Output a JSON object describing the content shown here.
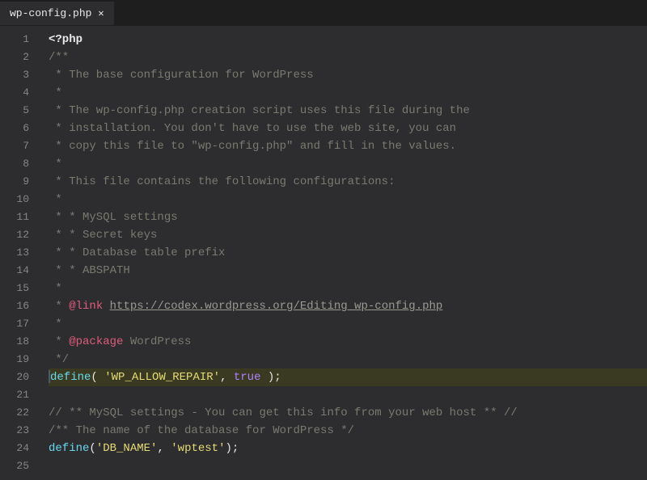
{
  "tab": {
    "filename": "wp-config.php",
    "close": "✕"
  },
  "lines": {
    "n1": "1",
    "n2": "2",
    "n3": "3",
    "n4": "4",
    "n5": "5",
    "n6": "6",
    "n7": "7",
    "n8": "8",
    "n9": "9",
    "n10": "10",
    "n11": "11",
    "n12": "12",
    "n13": "13",
    "n14": "14",
    "n15": "15",
    "n16": "16",
    "n17": "17",
    "n18": "18",
    "n19": "19",
    "n20": "20",
    "n21": "21",
    "n22": "22",
    "n23": "23",
    "n24": "24",
    "n25": "25"
  },
  "code": {
    "l1": "<?php",
    "l2": "/**",
    "l3": " * The base configuration for WordPress",
    "l4": " *",
    "l5": " * The wp-config.php creation script uses this file during the",
    "l6": " * installation. You don't have to use the web site, you can",
    "l7": " * copy this file to \"wp-config.php\" and fill in the values.",
    "l8": " *",
    "l9": " * This file contains the following configurations:",
    "l10": " *",
    "l11": " * * MySQL settings",
    "l12": " * * Secret keys",
    "l13": " * * Database table prefix",
    "l14": " * * ABSPATH",
    "l15": " *",
    "l16_prefix": " * ",
    "l16_tag": "@link",
    "l16_sep": " ",
    "l16_url": "https://codex.wordpress.org/Editing_wp-config.php",
    "l17": " *",
    "l18_prefix": " * ",
    "l18_tag": "@package",
    "l18_rest": " WordPress",
    "l19": " */",
    "l20_func": "define",
    "l20_p1": "( ",
    "l20_arg1": "'WP_ALLOW_REPAIR'",
    "l20_c": ", ",
    "l20_arg2": "true",
    "l20_p2": " );",
    "l22": "// ** MySQL settings - You can get this info from your web host ** //",
    "l23": "/** The name of the database for WordPress */",
    "l24_func": "define",
    "l24_p1": "(",
    "l24_arg1": "'DB_NAME'",
    "l24_c": ", ",
    "l24_arg2": "'wptest'",
    "l24_p2": ");"
  }
}
